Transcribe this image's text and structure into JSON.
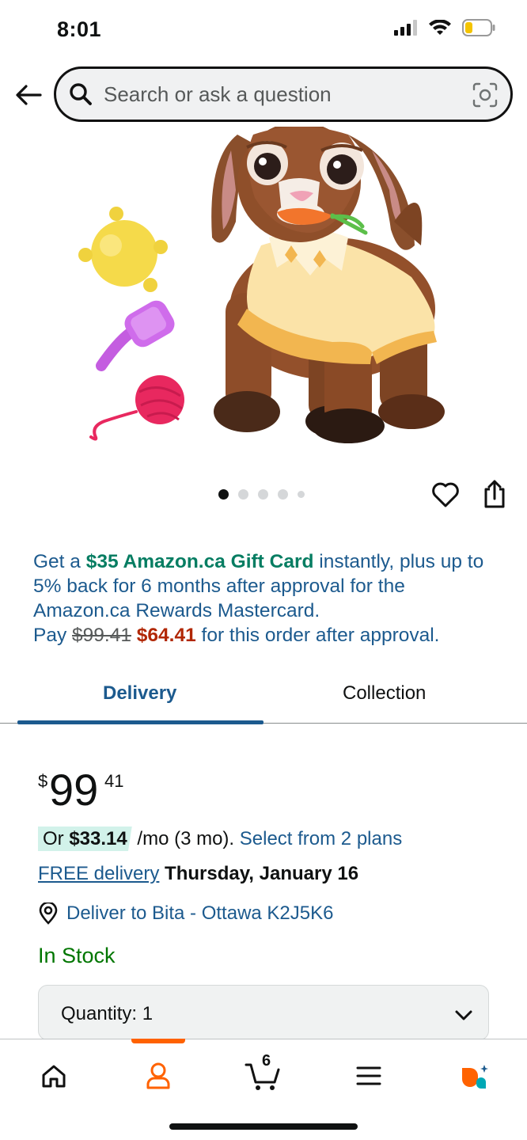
{
  "status_bar": {
    "time": "8:01"
  },
  "search": {
    "placeholder": "Search or ask a question"
  },
  "carousel": {
    "total": 5,
    "active_index": 0
  },
  "promo": {
    "prefix": "Get a ",
    "gift_card": "$35 Amazon.ca Gift Card",
    "middle": " instantly, plus up to 5% back for 6 months after approval for the Amazon.ca Rewards Mastercard.",
    "pay_label": "Pay ",
    "original_price": "$99.41",
    "sale_price": "$64.41",
    "suffix": " for this order after approval."
  },
  "tabs": [
    {
      "label": "Delivery",
      "selected": true
    },
    {
      "label": "Collection",
      "selected": false
    }
  ],
  "price": {
    "symbol": "$",
    "whole": "99",
    "fraction": "41"
  },
  "installment": {
    "prefix": "Or ",
    "amount": "$33.14",
    "term": " /mo (3 mo). ",
    "link": "Select from 2 plans"
  },
  "delivery": {
    "free_link": "FREE delivery",
    "date": " Thursday, January 16"
  },
  "location": {
    "text": "Deliver to Bita - Ottawa K2J5K6"
  },
  "stock": {
    "text": "In Stock"
  },
  "quantity": {
    "label": "Quantity: 1"
  },
  "nav": {
    "cart_count": "6"
  },
  "colors": {
    "link_blue": "#1c5a8e",
    "gift_green": "#067d62",
    "sale_red": "#b12704",
    "stock_green": "#007600",
    "accent_orange": "#ff6200"
  },
  "icons": [
    "back-arrow-icon",
    "search-icon",
    "camera-icon",
    "heart-icon",
    "share-icon",
    "location-pin-icon",
    "chevron-down-icon",
    "home-icon",
    "account-icon",
    "cart-icon",
    "menu-icon",
    "rufus-icon"
  ]
}
